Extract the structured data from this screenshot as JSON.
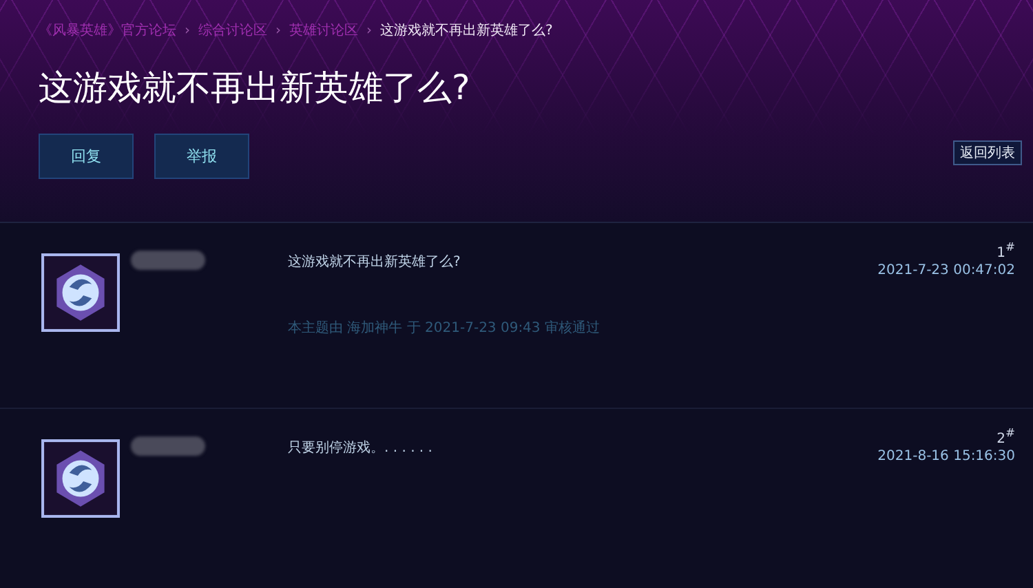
{
  "breadcrumb": [
    {
      "label": "《风暴英雄》官方论坛",
      "current": false
    },
    {
      "label": "综合讨论区",
      "current": false
    },
    {
      "label": "英雄讨论区",
      "current": false
    },
    {
      "label": "这游戏就不再出新英雄了么?",
      "current": true
    }
  ],
  "separator": "›",
  "title": "这游戏就不再出新英雄了么?",
  "actions": [
    "回复",
    "举报"
  ],
  "back_button": "返回列表",
  "posts": [
    {
      "floor": "1$^{#}$",
      "time": "2021-7-23 00:47:02",
      "content": "这游戏就不再出新英雄了么?",
      "note": "本主题由 海加神牛 于 2021-7-23 09:43 审核通过"
    },
    {
      "floor": "2$^{#}$",
      "time": "2021-8-16 15:16:30",
      "content": "只要别停游戏。. . . . . ."
    }
  ]
}
